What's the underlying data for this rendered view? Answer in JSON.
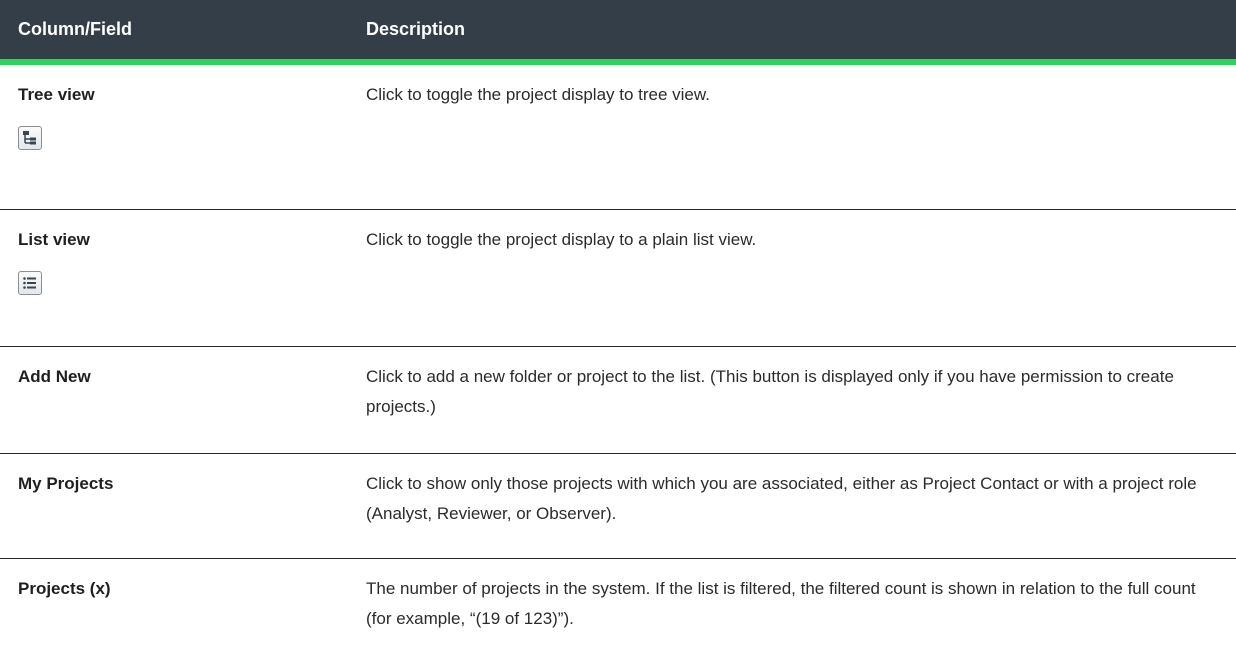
{
  "header": {
    "col1": "Column/Field",
    "col2": "Description"
  },
  "rows": [
    {
      "field": "Tree view",
      "description": "Click to toggle the project display to tree view.",
      "icon": "tree-view-icon"
    },
    {
      "field": "List view",
      "description": "Click to toggle the project display to a plain list view.",
      "icon": "list-view-icon"
    },
    {
      "field": "Add New",
      "description": "Click to add a new folder or project to the list. (This button is displayed only if you have permission to create projects.)"
    },
    {
      "field": "My Projects",
      "description": "Click to show only those projects with which you are associated, either as Project Contact or with a project role (Analyst, Reviewer, or Observer)."
    },
    {
      "field": "Projects (x)",
      "description": "The number of projects in the system. If the list is filtered, the filtered count is shown in relation to the full count (for example, “(19 of 123)”)."
    }
  ],
  "colors": {
    "header_bg": "#343e48",
    "header_accent": "#2fd35c",
    "row_divider": "#2b2b2b"
  }
}
